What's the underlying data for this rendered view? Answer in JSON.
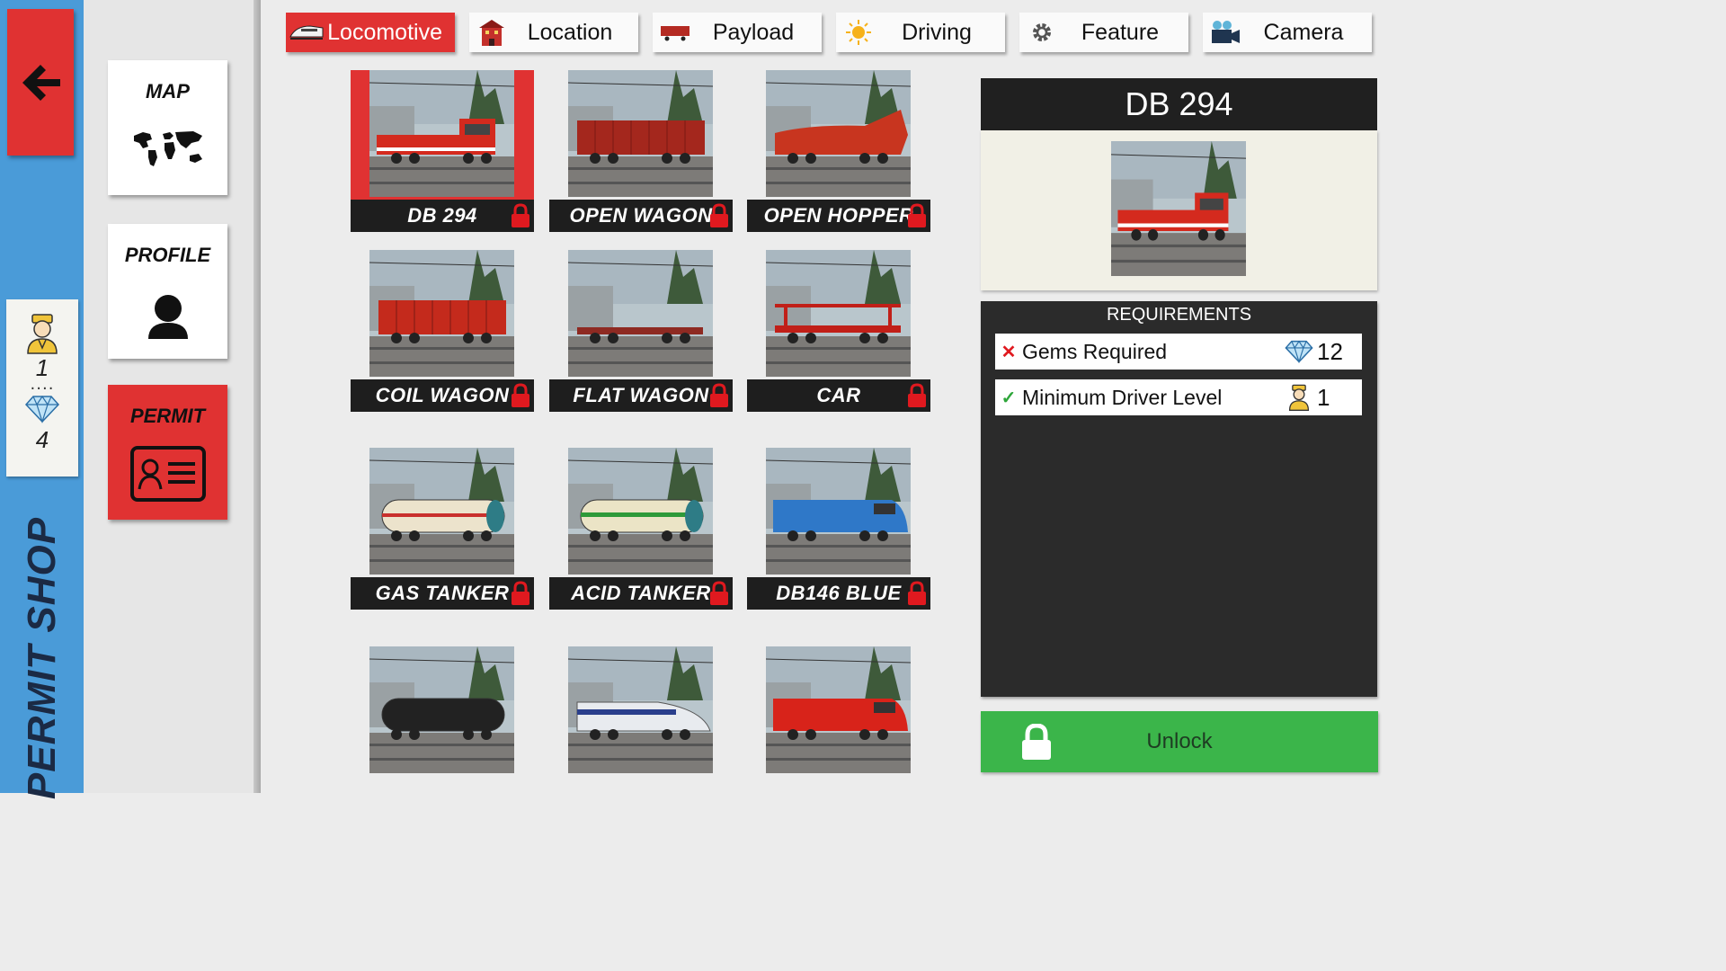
{
  "sidebar": {
    "title": "PERMIT SHOP",
    "driver_level": "1",
    "gems": "4"
  },
  "nav": {
    "map_label": "MAP",
    "profile_label": "PROFILE",
    "permit_label": "PERMIT"
  },
  "tabs": [
    {
      "label": "Locomotive",
      "icon": "train-icon",
      "active": true
    },
    {
      "label": "Location",
      "icon": "building-icon",
      "active": false
    },
    {
      "label": "Payload",
      "icon": "wagon-icon",
      "active": false
    },
    {
      "label": "Driving",
      "icon": "sun-icon",
      "active": false
    },
    {
      "label": "Feature",
      "icon": "gear-icon",
      "active": false
    },
    {
      "label": "Camera",
      "icon": "camera-icon",
      "active": false
    }
  ],
  "items": [
    {
      "name": "DB 294",
      "kind": "loco-red",
      "locked": true,
      "selected": true
    },
    {
      "name": "OPEN WAGON",
      "kind": "open-wagon",
      "locked": true
    },
    {
      "name": "OPEN HOPPER",
      "kind": "hopper",
      "locked": true
    },
    {
      "name": "COIL WAGON",
      "kind": "coil",
      "locked": true
    },
    {
      "name": "FLAT WAGON",
      "kind": "flat",
      "locked": true
    },
    {
      "name": "CAR",
      "kind": "car-carrier",
      "locked": true
    },
    {
      "name": "GAS TANKER",
      "kind": "gas-tanker",
      "locked": true
    },
    {
      "name": "ACID TANKER",
      "kind": "acid-tanker",
      "locked": true
    },
    {
      "name": "DB146 BLUE",
      "kind": "blue-loco",
      "locked": true
    },
    {
      "name": "",
      "kind": "black-tanker",
      "locked": true
    },
    {
      "name": "",
      "kind": "tgv",
      "locked": true
    },
    {
      "name": "",
      "kind": "red-loco",
      "locked": true
    }
  ],
  "detail": {
    "title": "DB 294",
    "requirements_title": "REQUIREMENTS",
    "requirements": [
      {
        "label": "Gems Required",
        "value": "12",
        "met": false,
        "icon": "diamond-icon"
      },
      {
        "label": "Minimum Driver Level",
        "value": "1",
        "met": true,
        "icon": "driver-icon"
      }
    ],
    "unlock_label": "Unlock"
  },
  "colors": {
    "accent_red": "#e03232",
    "sidebar_blue": "#4a9bd8",
    "unlock_green": "#3bb54a",
    "panel_dark": "#2b2b2b"
  }
}
